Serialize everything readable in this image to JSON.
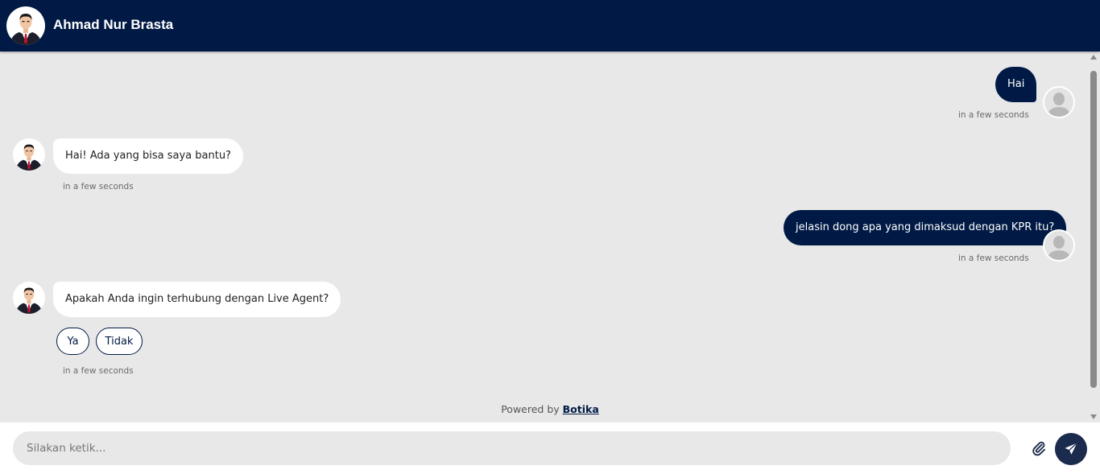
{
  "header": {
    "title": "Ahmad Nur Brasta"
  },
  "messages": [
    {
      "sender": "user",
      "text": "Hai",
      "time": "in a few seconds"
    },
    {
      "sender": "bot",
      "text": "Hai! Ada yang bisa saya bantu?",
      "time": "in a few seconds"
    },
    {
      "sender": "user",
      "text": "jelasin dong apa yang dimaksud dengan KPR itu?",
      "time": "in a few seconds"
    },
    {
      "sender": "bot",
      "text": "Apakah Anda ingin terhubung dengan Live Agent?",
      "time": "in a few seconds",
      "quick_replies": [
        "Ya",
        "Tidak"
      ]
    }
  ],
  "powered": {
    "prefix": "Powered by",
    "brand": "Botika"
  },
  "composer": {
    "placeholder": "Silakan ketik..."
  },
  "icons": {
    "attach": "paperclip-icon",
    "send": "paper-plane-icon",
    "avatar_bot": "person-suit-avatar",
    "avatar_user": "default-user-avatar"
  },
  "colors": {
    "primary": "#001a45",
    "chat_bg": "#e8e8e8",
    "bubble_bot": "#ffffff"
  }
}
